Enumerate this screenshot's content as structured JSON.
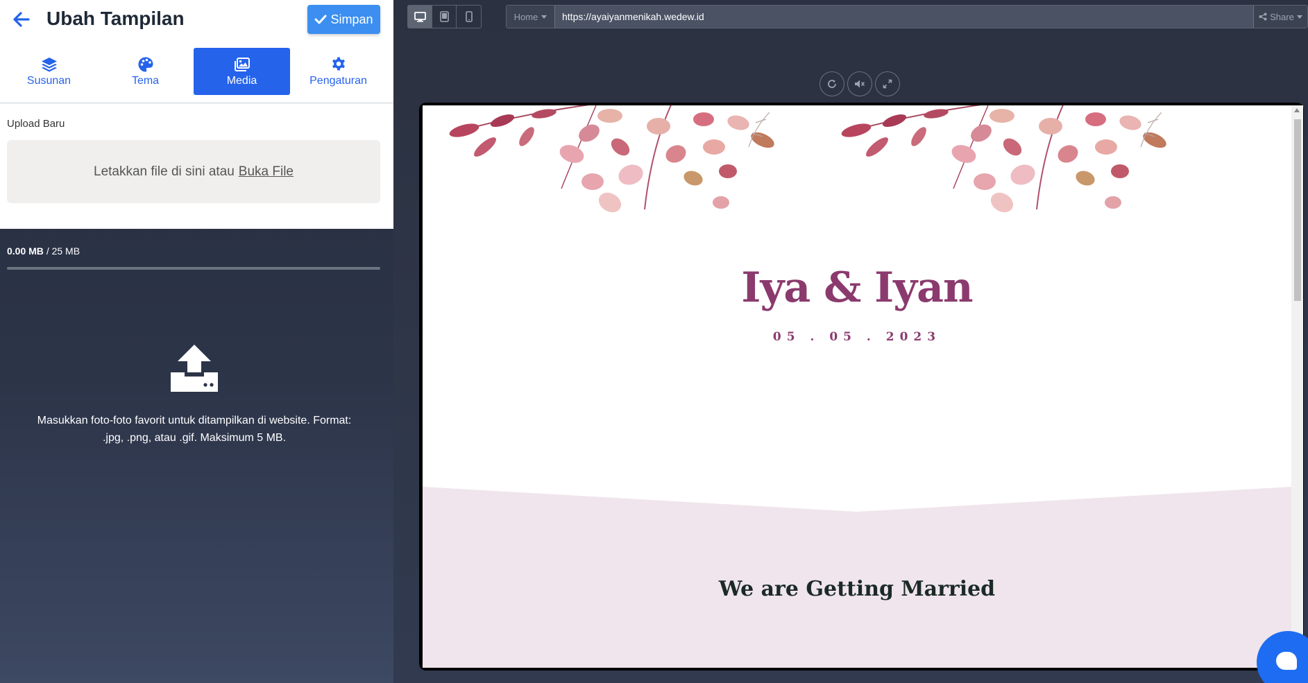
{
  "panel": {
    "title": "Ubah Tampilan",
    "save_label": "Simpan",
    "tabs": [
      {
        "label": "Susunan",
        "icon": "layers-icon"
      },
      {
        "label": "Tema",
        "icon": "palette-icon"
      },
      {
        "label": "Media",
        "icon": "images-icon",
        "active": true
      },
      {
        "label": "Pengaturan",
        "icon": "gear-icon"
      }
    ],
    "upload_label": "Upload Baru",
    "dropzone_text": "Letakkan file di sini atau",
    "dropzone_link": "Buka File",
    "storage_used": "0.00 MB",
    "storage_total": "/ 25 MB",
    "storage_fraction": 0,
    "upload_hint": "Masukkan foto-foto favorit untuk ditampilkan di website. Format: .jpg, .png, atau .gif. Maksimum 5 MB."
  },
  "toolbar": {
    "page_select": "Home",
    "url": "https://ayaiyanmenikah.wedew.id",
    "share_label": "Share"
  },
  "preview": {
    "couple_names": "Iya & Iyan",
    "date": "05 . 05 . 2023",
    "section_title": "We are Getting Married"
  },
  "colors": {
    "accent": "#2563eb",
    "save_button": "#3c8ff0",
    "names": "#8b3a6e",
    "section_bg": "#f0e5ec"
  }
}
